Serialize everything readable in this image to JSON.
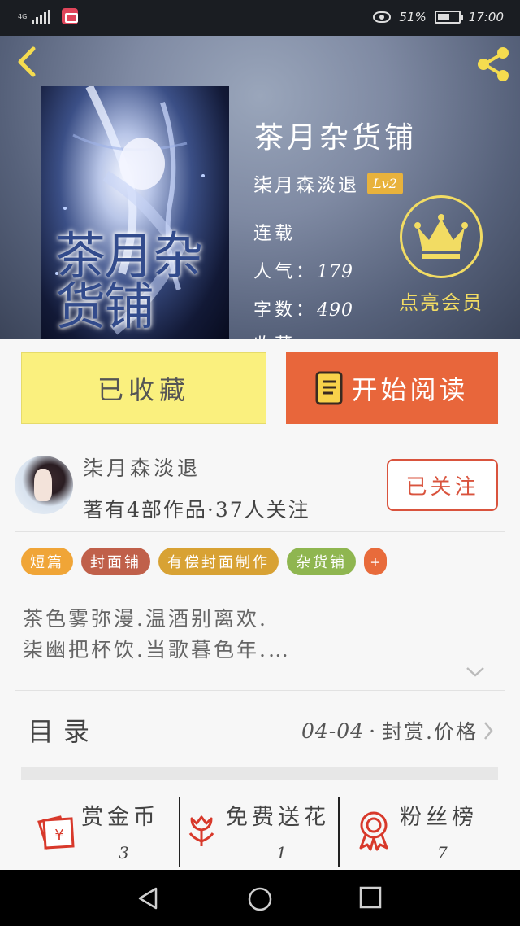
{
  "status_bar": {
    "network": "4G",
    "battery_percent": "51%",
    "time": "17:00"
  },
  "book": {
    "title": "茶月杂货铺",
    "cover_title": "茶月杂货铺",
    "author": "柒月森淡退",
    "level": "Lv2",
    "status": "连载",
    "popularity_label": "人气：",
    "popularity": "179",
    "word_count_label": "字数：",
    "word_count": "490",
    "favorites_label_partial": "收藏："
  },
  "vip": {
    "label": "点亮会员",
    "color": "#f2dc63"
  },
  "buttons": {
    "collected": "已收藏",
    "start_reading": "开始阅读",
    "follow": "已关注"
  },
  "author_info": {
    "name": "柒月森淡退",
    "works_summary": "著有4部作品·37人关注"
  },
  "tags": [
    {
      "label": "短篇",
      "color": "#f0a537"
    },
    {
      "label": "封面铺",
      "color": "#c0604a"
    },
    {
      "label": "有偿封面制作",
      "color": "#d8a234"
    },
    {
      "label": "杂货铺",
      "color": "#8fb650"
    }
  ],
  "more_tags_label": "+",
  "description": {
    "line1": "茶色雾弥漫.温酒别离欢.",
    "line2": "柒幽把杯饮.当歌暮色年.…"
  },
  "toc": {
    "label": "目录",
    "latest_date": "04-04",
    "latest_sep": "·",
    "latest_title": "封赏.价格"
  },
  "actions": [
    {
      "label": "赏金币",
      "count": "3",
      "icon": "red-envelope-icon"
    },
    {
      "label": "免费送花",
      "count": "1",
      "icon": "flower-icon"
    },
    {
      "label": "粉丝榜",
      "count": "7",
      "icon": "medal-icon"
    }
  ],
  "colors": {
    "accent_orange": "#e8663b",
    "collected_yellow": "#faf07e",
    "follow_red": "#d9533d",
    "icon_red": "#d8392b"
  }
}
